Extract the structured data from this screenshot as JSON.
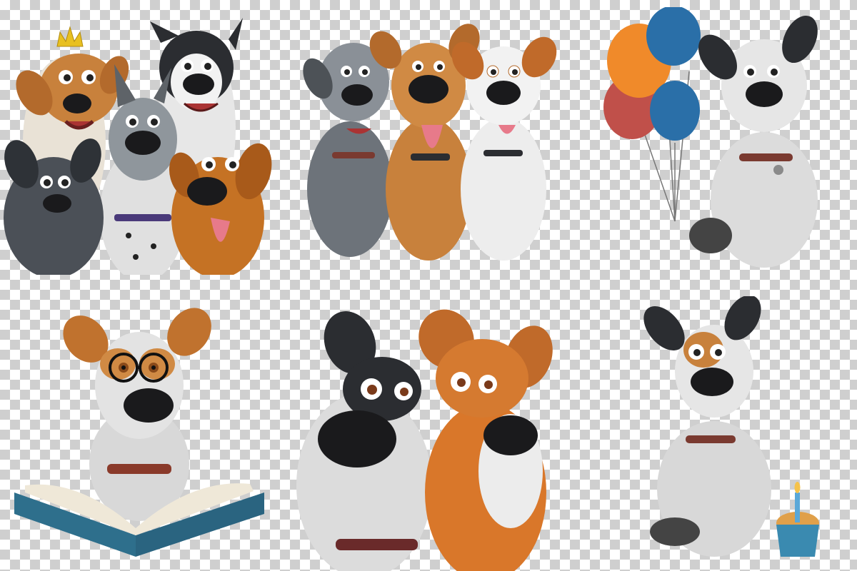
{
  "canvas": {
    "background": "transparency-checkerboard",
    "checker_colors": [
      "#ffffff",
      "#cfcfcf"
    ]
  },
  "palette": {
    "tan": "#c8813c",
    "orange": "#d9772a",
    "gray": "#9aa0a6",
    "dark": "#2b2d31",
    "white": "#ececec",
    "nose": "#1a1a1c",
    "collar_red": "#7a3a30",
    "collar_purple": "#4a3a7a",
    "balloon_orange": "#f08a2a",
    "balloon_blue": "#2a6fa8",
    "balloon_red": "#c0504a",
    "book_blue": "#2e6f8c",
    "cupcake_blue": "#3a8ab0",
    "crown_gold": "#e8c020"
  },
  "illustrations": [
    {
      "id": "dog-group-with-crown",
      "icons": [
        "crown-icon"
      ]
    },
    {
      "id": "three-dogs-sitting"
    },
    {
      "id": "dog-with-balloons",
      "icons": [
        "balloon-icon"
      ]
    },
    {
      "id": "dog-reading-book",
      "icons": [
        "glasses-icon",
        "book-icon"
      ]
    },
    {
      "id": "two-dogs-closeup"
    },
    {
      "id": "dog-with-cupcake",
      "icons": [
        "cupcake-icon",
        "candle-icon"
      ]
    }
  ]
}
